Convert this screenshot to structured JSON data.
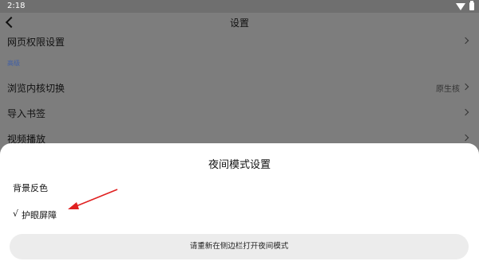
{
  "status_bar": {
    "time": "2:18"
  },
  "page": {
    "title": "设置",
    "rows": [
      {
        "label": "网页权限设置"
      },
      {
        "label": "浏览内核切换",
        "value": "原生核"
      },
      {
        "label": "导入书签"
      },
      {
        "label": "视频播放"
      }
    ],
    "section_header": "高级"
  },
  "dialog": {
    "title": "夜间模式设置",
    "options": [
      {
        "label": "背景反色",
        "checked": false
      },
      {
        "label": "护眼屏障",
        "checked": true,
        "check_mark": "√"
      }
    ],
    "button_label": "请重新在侧边栏打开夜间模式"
  },
  "colors": {
    "arrow": "#e02020",
    "section_header": "#3f5fa8",
    "dim_overlay": "#7d7d7d"
  }
}
